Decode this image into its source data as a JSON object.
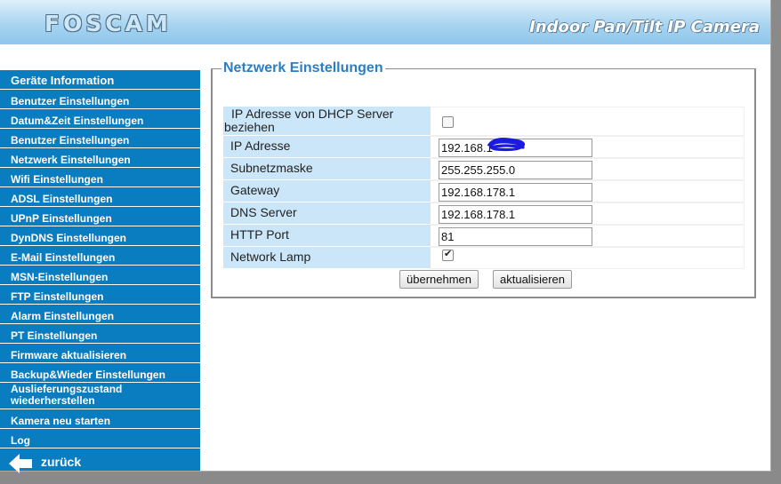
{
  "header": {
    "logo": "FOSCAM",
    "product": "Indoor Pan/Tilt IP Camera"
  },
  "sidebar": {
    "items": [
      "Geräte Information",
      "Benutzer Einstellungen",
      "Datum&Zeit Einstellungen",
      "Benutzer Einstellungen",
      "Netzwerk Einstellungen",
      "Wifi Einstellungen",
      "ADSL Einstellungen",
      "UPnP Einstellungen",
      "DynDNS Einstellungen",
      "E-Mail Einstellungen",
      "MSN-Einstellungen",
      "FTP Einstellungen",
      "Alarm Einstellungen",
      "PT Einstellungen",
      "Firmware aktualisieren",
      "Backup&Wieder Einstellungen",
      "Auslieferungszustand wiederherstellen",
      "Kamera neu starten",
      "Log"
    ],
    "back_label": "zurück"
  },
  "section": {
    "title": "Netzwerk Einstellungen"
  },
  "form": {
    "dhcp": {
      "label": "IP Adresse von DHCP Server beziehen",
      "checked": false
    },
    "ip": {
      "label": "IP Adresse",
      "value": "192.168.1"
    },
    "subnet": {
      "label": "Subnetzmaske",
      "value": "255.255.255.0"
    },
    "gateway": {
      "label": "Gateway",
      "value": "192.168.178.1"
    },
    "dns": {
      "label": "DNS Server",
      "value": "192.168.178.1"
    },
    "http_port": {
      "label": "HTTP Port",
      "value": "81"
    },
    "network_lamp": {
      "label": "Network Lamp",
      "checked": true
    }
  },
  "buttons": {
    "apply": "übernehmen",
    "refresh": "aktualisieren"
  },
  "colors": {
    "sidebar": "#0a7cc0",
    "label_bg": "#cbe6f8",
    "title": "#2a7dc7",
    "redaction": "#1a1ae0"
  }
}
